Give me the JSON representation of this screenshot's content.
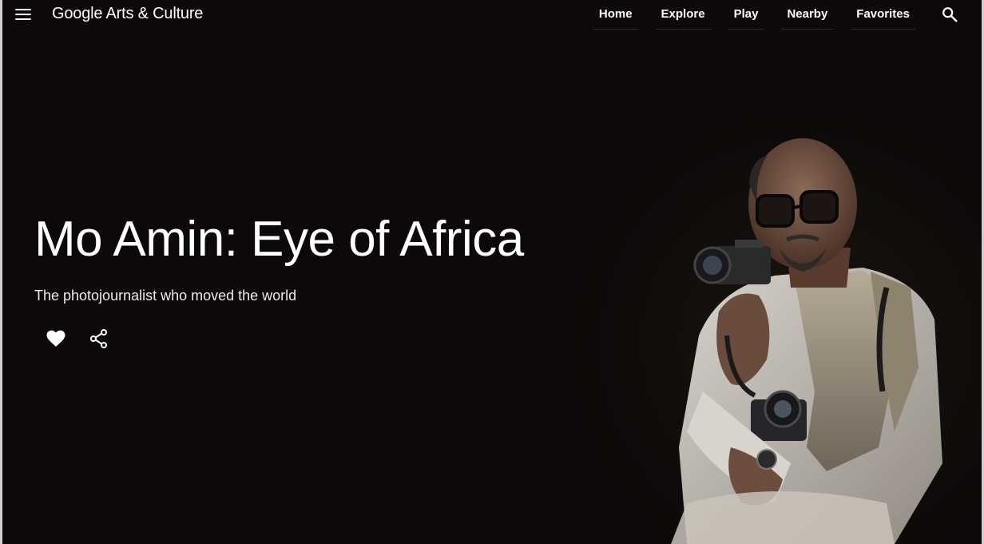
{
  "header": {
    "logo_text": "Google Arts & Culture",
    "nav": [
      {
        "label": "Home"
      },
      {
        "label": "Explore"
      },
      {
        "label": "Play"
      },
      {
        "label": "Nearby"
      },
      {
        "label": "Favorites"
      }
    ],
    "menu_icon": "hamburger-menu-icon",
    "search_icon": "search-icon"
  },
  "hero": {
    "title": "Mo Amin: Eye of Africa",
    "subtitle": "The photojournalist who moved the world",
    "favorite_icon": "heart-icon",
    "share_icon": "share-icon",
    "image_subject": "portrait-photo"
  },
  "colors": {
    "background": "#0c0908",
    "text": "#ffffff"
  }
}
